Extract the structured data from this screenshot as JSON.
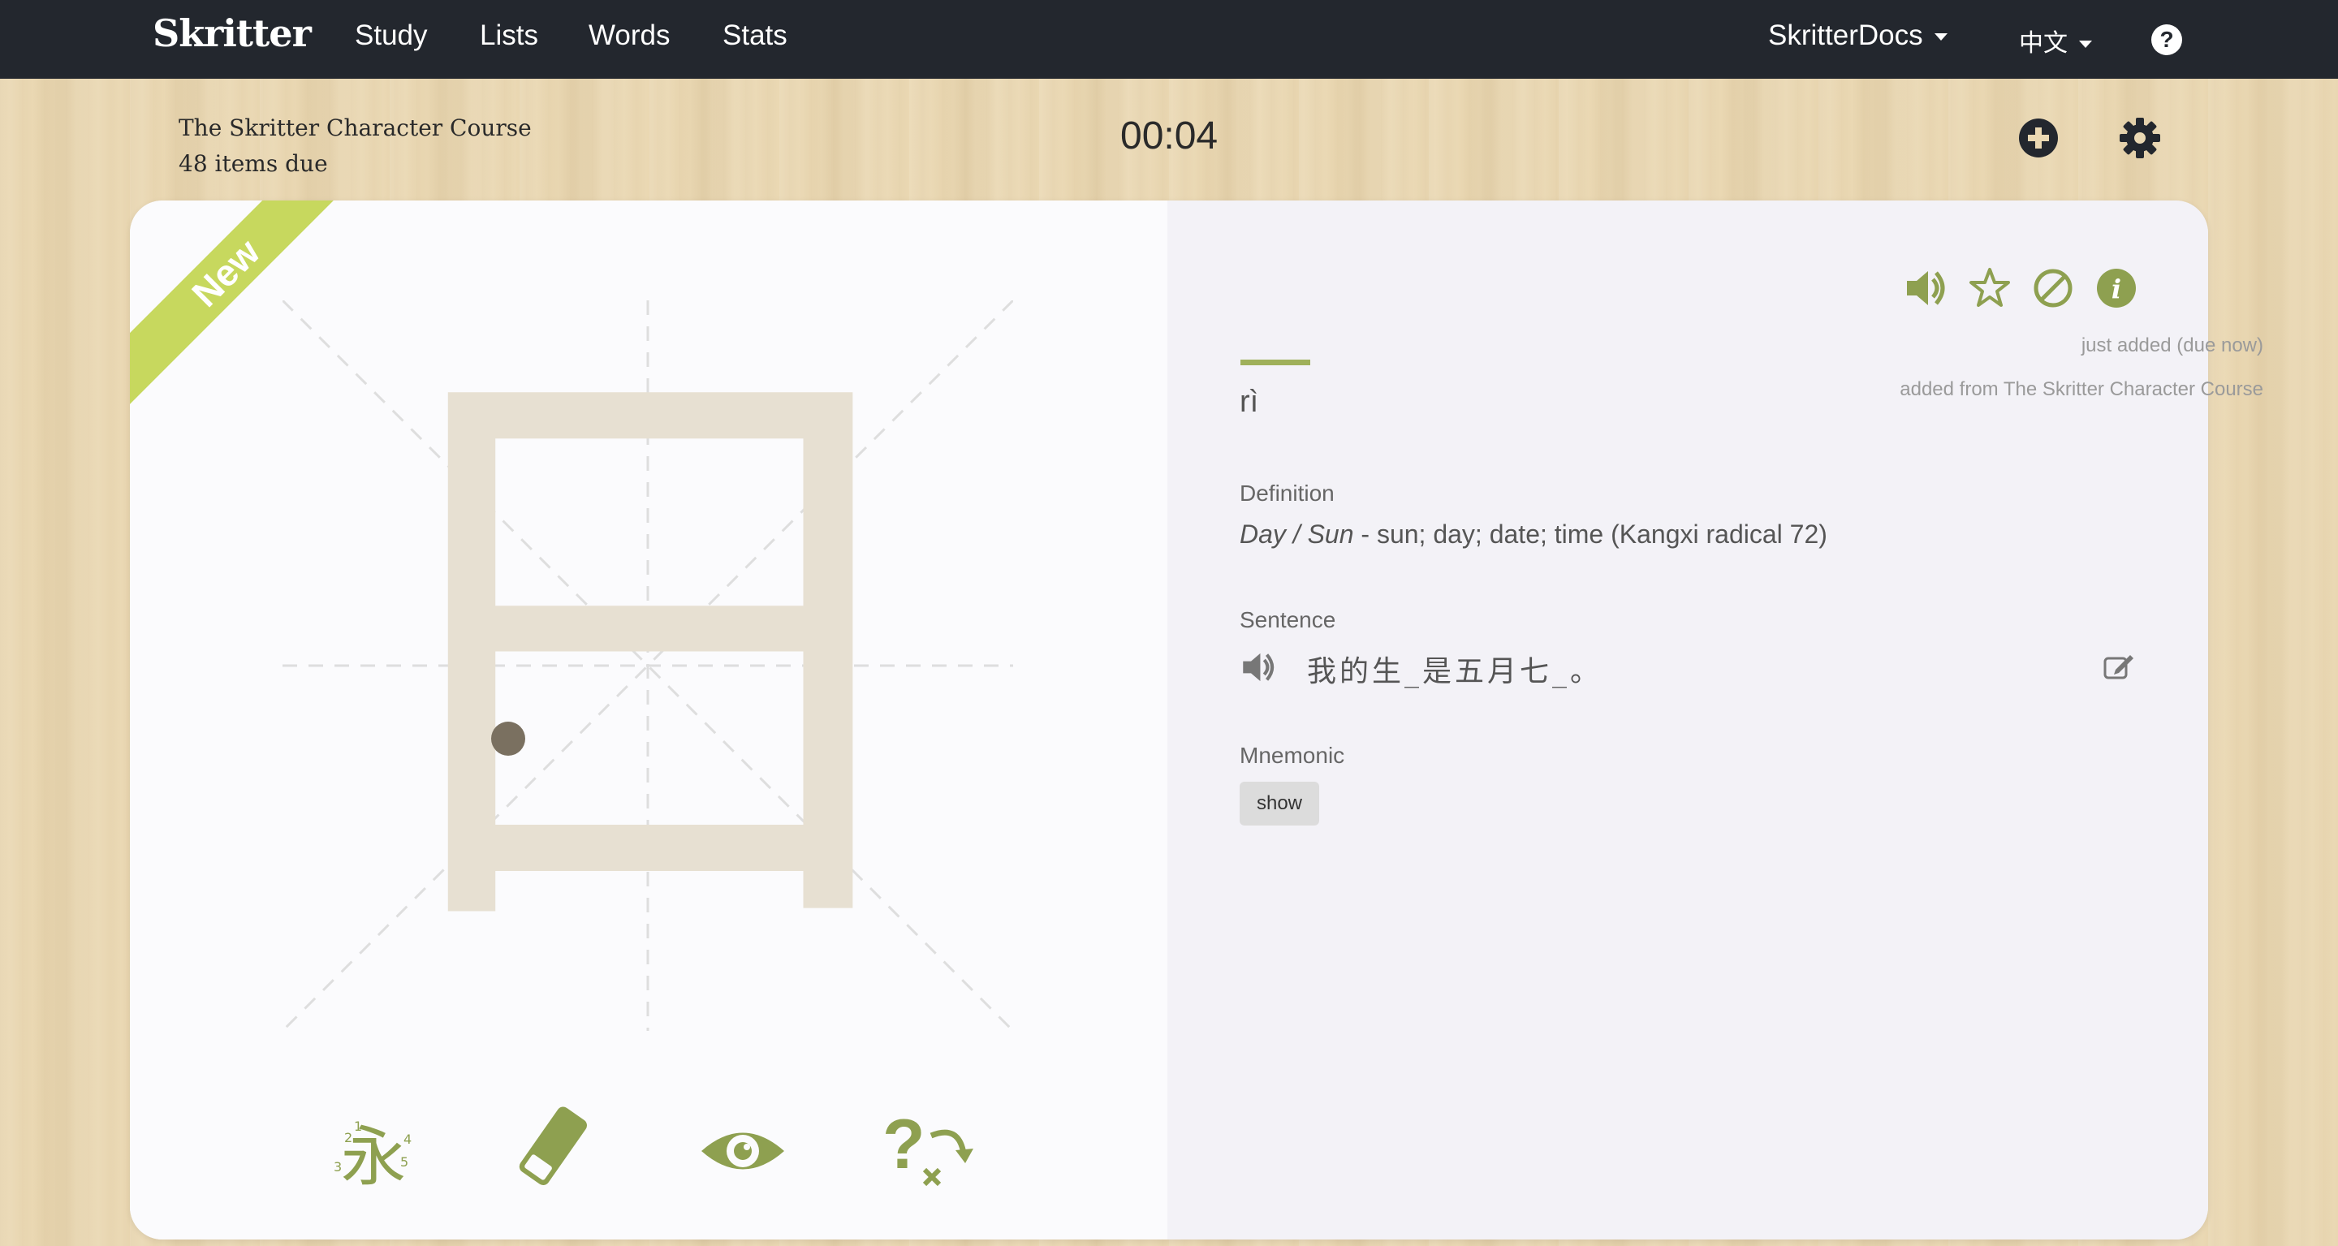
{
  "nav": {
    "brand": "Skritter",
    "items": [
      "Study",
      "Lists",
      "Words",
      "Stats"
    ],
    "account": "SkritterDocs",
    "language": "中文",
    "help": "?"
  },
  "session": {
    "course": "The Skritter Character Course",
    "due": "48 items due",
    "timer": "00:04"
  },
  "card": {
    "badge": "New",
    "character": "日",
    "status": "just added (due now)",
    "source": "added from The Skritter Character Course",
    "pinyin": "rì",
    "definition_label": "Definition",
    "definition_keyword": "Day / Sun",
    "definition_text": " - sun; day; date; time (Kangxi radical 72)",
    "sentence_label": "Sentence",
    "sentence": "我的生_是五月七_。",
    "mnemonic_label": "Mnemonic",
    "mnemonic_button": "show"
  },
  "icons": {
    "top": [
      "add-circle-icon",
      "gear-icon"
    ],
    "card_actions": [
      "speaker-icon",
      "star-icon",
      "ban-icon",
      "info-icon"
    ],
    "tools": [
      "stroke-order-icon",
      "eraser-icon",
      "eye-icon",
      "hint-skip-icon"
    ]
  },
  "colors": {
    "accent": "#8ea050",
    "ribbon": "#c7d85e",
    "topbar": "#23272e",
    "stroke": "#e7e0d2"
  }
}
